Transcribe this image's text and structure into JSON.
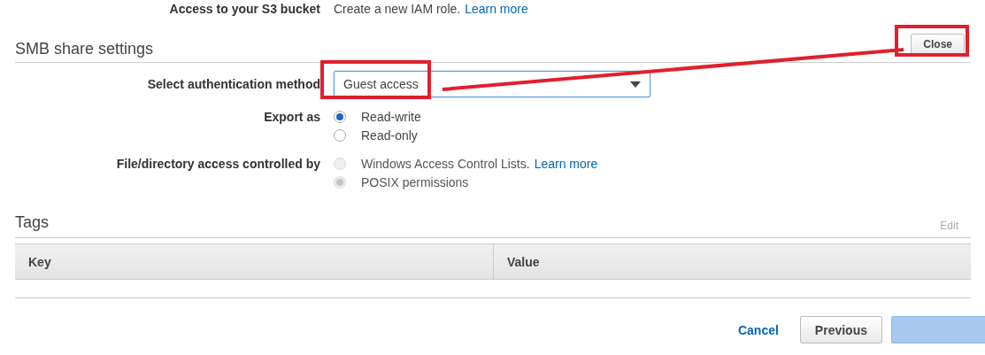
{
  "s3_access": {
    "label": "Access to your S3 bucket",
    "text": "Create a new IAM role.",
    "link": "Learn more"
  },
  "smb_section": {
    "title": "SMB share settings",
    "close_button": {
      "label": "Close",
      "highlighted": true
    },
    "auth_method": {
      "label": "Select authentication method",
      "value": "Guest access",
      "highlighted": true
    },
    "export_as": {
      "label": "Export as",
      "options": [
        {
          "label": "Read-write",
          "selected": true,
          "disabled": false
        },
        {
          "label": "Read-only",
          "selected": false,
          "disabled": false
        }
      ]
    },
    "access_control": {
      "label": "File/directory access controlled by",
      "options": [
        {
          "label": "Windows Access Control Lists.",
          "link": "Learn more",
          "selected": false,
          "disabled": true
        },
        {
          "label": "POSIX permissions",
          "selected": true,
          "disabled": true
        }
      ]
    }
  },
  "tags": {
    "title": "Tags",
    "edit": "Edit",
    "columns": [
      "Key",
      "Value"
    ]
  },
  "footer": {
    "buttons": [
      {
        "kind": "link",
        "label": "Cancel"
      },
      {
        "kind": "secondary",
        "label": "Previous"
      },
      {
        "kind": "primary"
      }
    ]
  }
}
